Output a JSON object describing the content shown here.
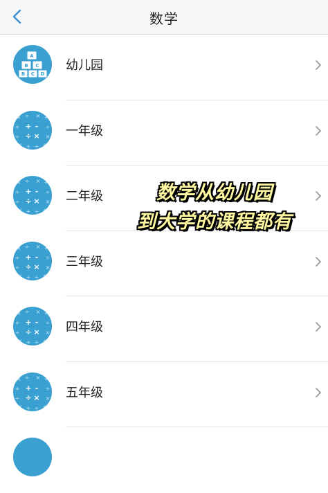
{
  "header": {
    "title": "数学",
    "back_icon": "chevron-left-icon"
  },
  "list": {
    "items": [
      {
        "label": "幼儿园",
        "icon": "blocks-icon"
      },
      {
        "label": "一年级",
        "icon": "math-symbols-icon"
      },
      {
        "label": "二年级",
        "icon": "math-symbols-icon"
      },
      {
        "label": "三年级",
        "icon": "math-symbols-icon"
      },
      {
        "label": "四年级",
        "icon": "math-symbols-icon"
      },
      {
        "label": "五年级",
        "icon": "math-symbols-icon"
      }
    ]
  },
  "overlay": {
    "line1": "数学从幼儿园",
    "line2": "到大学的课程都有"
  },
  "colors": {
    "accent": "#3aa0d2",
    "overlay_text": "#fff8a0"
  }
}
